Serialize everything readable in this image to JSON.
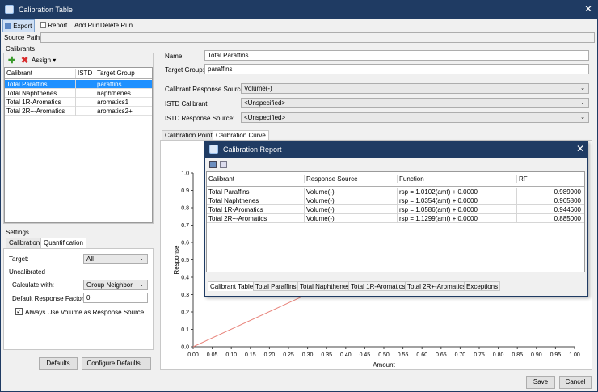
{
  "window": {
    "title": "Calibration Table"
  },
  "toolbar": {
    "export": "Export",
    "report": "Report",
    "add_run": "Add Run",
    "delete_run": "Delete Run"
  },
  "source_path": {
    "label": "Source Path:",
    "value": ""
  },
  "calibrants": {
    "group_label": "Calibrants",
    "assign_label": "Assign",
    "columns": [
      "Calibrant",
      "ISTD",
      "Target Group"
    ],
    "rows": [
      {
        "name": "Total Paraffins",
        "istd": "",
        "group": "paraffins"
      },
      {
        "name": "Total Naphthenes",
        "istd": "",
        "group": "naphthenes"
      },
      {
        "name": "Total 1R-Aromatics",
        "istd": "",
        "group": "aromatics1"
      },
      {
        "name": "Total 2R+-Aromatics",
        "istd": "",
        "group": "aromatics2+"
      }
    ]
  },
  "settings": {
    "group_label": "Settings",
    "tabs": [
      "Calibration",
      "Quantification"
    ],
    "target_label": "Target:",
    "target_value": "All",
    "uncalibrated_label": "Uncalibrated",
    "calc_label": "Calculate with:",
    "calc_value": "Group Neighbor",
    "drf_label": "Default Response Factor:",
    "drf_value": "0",
    "always_label": "Always Use Volume as Response Source"
  },
  "buttons": {
    "defaults": "Defaults",
    "configure": "Configure Defaults...",
    "save": "Save",
    "cancel": "Cancel"
  },
  "detail": {
    "name_label": "Name:",
    "name_value": "Total Paraffins",
    "target_group_label": "Target Group:",
    "target_group_value": "paraffins",
    "crs_label": "Calibrant Response Source:",
    "crs_value": "Volume(-)",
    "istd_cal_label": "ISTD Calibrant:",
    "istd_cal_value": "<Unspecified>",
    "istd_rs_label": "ISTD Response Source:",
    "istd_rs_value": "<Unspecified>"
  },
  "plot_tabs": [
    "Calibration Points",
    "Calibration Curve"
  ],
  "chart_data": {
    "type": "line",
    "xlabel": "Amount",
    "ylabel": "Response",
    "xlim": [
      0,
      1.0
    ],
    "ylim": [
      0,
      1.0
    ],
    "x_ticks": [
      "0.00",
      "0.05",
      "0.10",
      "0.15",
      "0.20",
      "0.25",
      "0.30",
      "0.35",
      "0.40",
      "0.45",
      "0.50",
      "0.55",
      "0.60",
      "0.65",
      "0.70",
      "0.75",
      "0.80",
      "0.85",
      "0.90",
      "0.95",
      "1.00"
    ],
    "y_ticks": [
      "0.0",
      "0.1",
      "0.2",
      "0.3",
      "0.4",
      "0.5",
      "0.6",
      "0.7",
      "0.8",
      "0.9",
      "1.0"
    ],
    "series": [
      {
        "x": [
          0,
          0.3
        ],
        "y": [
          0,
          0.303
        ],
        "color": "#e8837a"
      }
    ]
  },
  "report": {
    "title": "Calibration Report",
    "columns": [
      "Calibrant",
      "Response Source",
      "Function",
      "RF"
    ],
    "rows": [
      {
        "cal": "Total Paraffins",
        "src": "Volume(-)",
        "fn": "rsp = 1.0102(amt) + 0.0000",
        "rf": "0.989900"
      },
      {
        "cal": "Total Naphthenes",
        "src": "Volume(-)",
        "fn": "rsp = 1.0354(amt) + 0.0000",
        "rf": "0.965800"
      },
      {
        "cal": "Total 1R-Aromatics",
        "src": "Volume(-)",
        "fn": "rsp = 1.0586(amt) + 0.0000",
        "rf": "0.944600"
      },
      {
        "cal": "Total 2R+-Aromatics",
        "src": "Volume(-)",
        "fn": "rsp = 1.1299(amt) + 0.0000",
        "rf": "0.885000"
      }
    ],
    "tabs": [
      "Calibrant Table",
      "Total Paraffins",
      "Total Naphthenes",
      "Total 1R-Aromatics",
      "Total 2R+-Aromatics",
      "Exceptions"
    ]
  }
}
